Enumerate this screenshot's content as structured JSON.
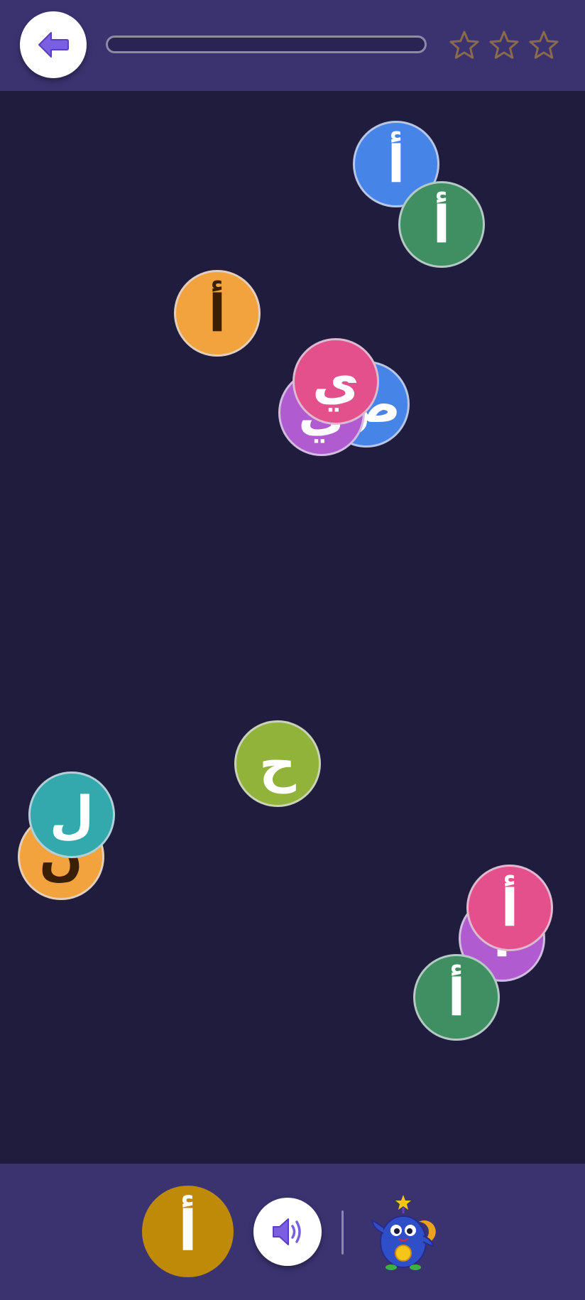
{
  "header": {
    "back_icon": "arrow-left-icon",
    "progress": 0,
    "stars_total": 3,
    "stars_filled": 0
  },
  "bubbles": [
    {
      "letter": "أ",
      "color": "#4784e8",
      "text_color": "#ffffff"
    },
    {
      "letter": "أ",
      "color": "#3f8f62",
      "text_color": "#ffffff"
    },
    {
      "letter": "أ",
      "color": "#f2a33e",
      "text_color": "#3a1f05"
    },
    {
      "letter": "ص",
      "color": "#4784e8",
      "text_color": "#ffffff"
    },
    {
      "letter": "ي",
      "color": "#b05bd0",
      "text_color": "#ffffff"
    },
    {
      "letter": "ي",
      "color": "#e4508c",
      "text_color": "#ffffff"
    },
    {
      "letter": "ح",
      "color": "#92b33a",
      "text_color": "#ffffff"
    },
    {
      "letter": "ن",
      "color": "#f2a33e",
      "text_color": "#3a1f05"
    },
    {
      "letter": "ل",
      "color": "#33a8ad",
      "text_color": "#ffffff"
    },
    {
      "letter": "أ",
      "color": "#b05bd0",
      "text_color": "#ffffff"
    },
    {
      "letter": "أ",
      "color": "#3f8f62",
      "text_color": "#ffffff"
    },
    {
      "letter": "أ",
      "color": "#e4508c",
      "text_color": "#ffffff"
    }
  ],
  "footer": {
    "target_letter": "أ",
    "sound_icon": "speaker-icon",
    "mascot": "alien-mascot"
  }
}
